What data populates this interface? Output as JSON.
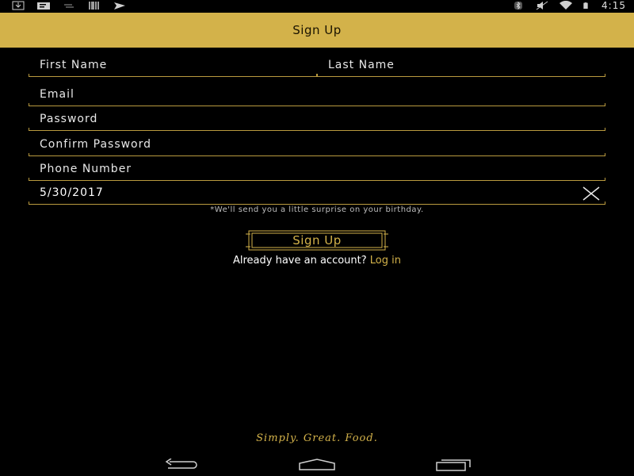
{
  "status_bar": {
    "time": "4:15",
    "left_icons": [
      "download-icon",
      "message-icon",
      "sync-icon",
      "barcode-icon",
      "send-icon"
    ],
    "right_icons": [
      "bluetooth-icon",
      "mute-icon",
      "wifi-icon",
      "battery-icon"
    ]
  },
  "app_bar": {
    "title": "Sign Up"
  },
  "form": {
    "first_name": {
      "placeholder": "First Name"
    },
    "last_name": {
      "placeholder": "Last Name"
    },
    "email": {
      "placeholder": "Email"
    },
    "password": {
      "placeholder": "Password"
    },
    "confirm_password": {
      "placeholder": "Confirm Password"
    },
    "phone": {
      "placeholder": "Phone Number"
    },
    "birthday": {
      "value": "5/30/2017"
    },
    "birthday_hint": "*We'll send you a little surprise on your birthday."
  },
  "signup_button": {
    "label": "Sign Up"
  },
  "login_prompt": {
    "text": "Already have an account?",
    "link": "Log in"
  },
  "tagline": "Simply. Great. Food.",
  "colors": {
    "accent": "#d3b24a",
    "background": "#000000",
    "appbar_text": "#1a1300"
  }
}
